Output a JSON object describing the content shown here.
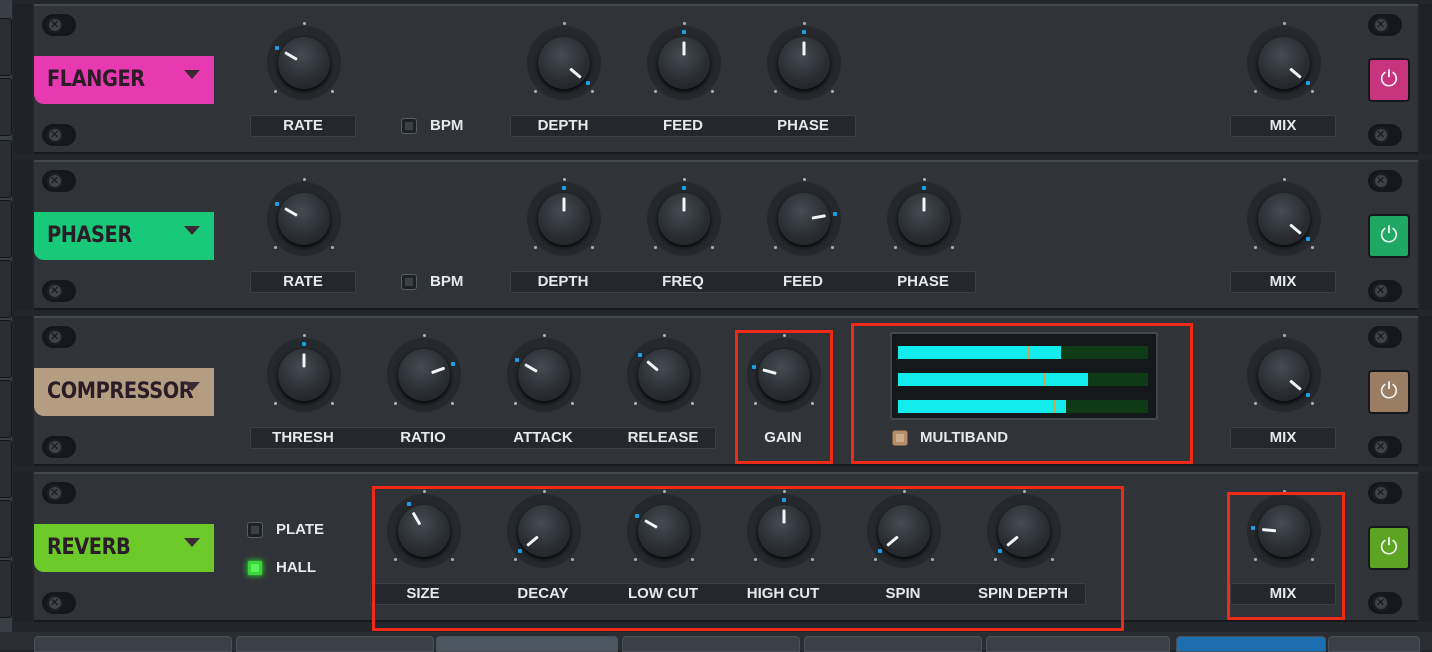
{
  "window": {
    "title": ""
  },
  "effects": {
    "flanger": {
      "name": "FLANGER",
      "color": "#e83ab0",
      "knobs": {
        "rate": "RATE",
        "depth": "DEPTH",
        "feed": "FEED",
        "phase": "PHASE",
        "mix": "MIX"
      },
      "bpm_label": "BPM",
      "bpm_checked": false,
      "power_on": true,
      "power_color": "#c8337e"
    },
    "phaser": {
      "name": "PHASER",
      "color": "#19c97a",
      "knobs": {
        "rate": "RATE",
        "depth": "DEPTH",
        "freq": "FREQ",
        "feed": "FEED",
        "phase": "PHASE",
        "mix": "MIX"
      },
      "bpm_label": "BPM",
      "bpm_checked": false,
      "power_on": true,
      "power_color": "#1ea862"
    },
    "compressor": {
      "name": "COMPRESSOR",
      "color": "#b59d82",
      "knobs": {
        "thresh": "THRESH",
        "ratio": "RATIO",
        "attack": "ATTACK",
        "release": "RELEASE",
        "gain": "GAIN",
        "mix": "MIX"
      },
      "multiband_label": "MULTIBAND",
      "multiband_checked": true,
      "meter_levels": [
        0.65,
        0.76,
        0.67
      ],
      "power_on": true,
      "power_color": "#9a7d63"
    },
    "reverb": {
      "name": "REVERB",
      "color": "#6cc92a",
      "knobs": {
        "size": "SIZE",
        "decay": "DECAY",
        "low_cut": "LOW CUT",
        "high_cut": "HIGH CUT",
        "spin": "SPIN",
        "spin_depth": "SPIN DEPTH",
        "mix": "MIX"
      },
      "modes": {
        "plate": "PLATE",
        "hall": "HALL"
      },
      "selected_mode": "HALL",
      "power_on": true,
      "power_color": "#5da422"
    }
  },
  "colors": {
    "accent": "#1aa0e8",
    "meter_fill": "#13ecec",
    "highlight": "#f02a18"
  },
  "icons": {
    "screw": "screw-icon",
    "power": "power-icon",
    "dropdown": "chevron-down-icon"
  }
}
